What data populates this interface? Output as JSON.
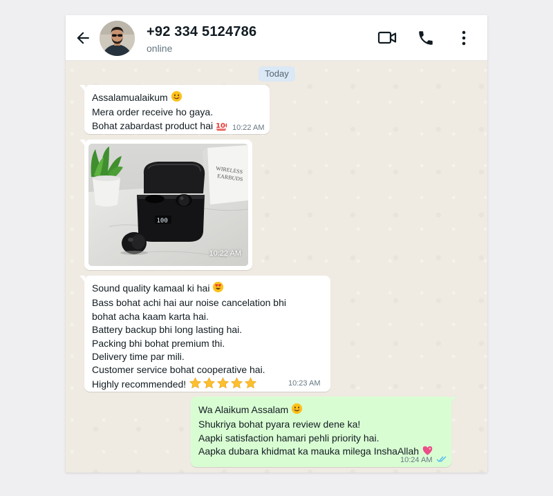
{
  "header": {
    "contact_name": "+92 334 5124786",
    "status": "online",
    "icons": [
      "back-arrow-icon",
      "video-call-icon",
      "phone-icon",
      "more-options-icon"
    ]
  },
  "chat": {
    "date_label": "Today",
    "messages": [
      {
        "direction": "incoming",
        "lines": [
          "Assalamualaikum",
          "Mera order receive ho gaya.",
          "Bohat zabardast product hai"
        ],
        "emojis": [
          "smiling-face-emoji",
          "hundred-points-emoji"
        ],
        "time": "10:22 AM"
      },
      {
        "direction": "incoming",
        "type": "image",
        "image_description": "black wireless earbuds charging case showing 100 on LED display with box",
        "case_display": "100",
        "box_text": [
          "WIRELESS",
          "EARBUDS"
        ],
        "time": "10:22 AM"
      },
      {
        "direction": "incoming",
        "lines": [
          "Sound quality kamaal ki hai",
          "Bass bohat achi hai aur noise cancelation bhi",
          "bohat acha kaam karta hai.",
          "Battery backup bhi long lasting hai.",
          "Packing bhi bohat premium thi.",
          "Delivery time par mili.",
          "Customer service bohat cooperative hai.",
          "Highly recommended!"
        ],
        "emojis": [
          "heart-eyes-emoji",
          "star-emoji"
        ],
        "rating_stars": 5,
        "time": "10:23 AM"
      },
      {
        "direction": "outgoing",
        "lines": [
          "Wa Alaikum Assalam",
          "Shukriya bohat pyara review dene ka!",
          "Aapki satisfaction hamari pehli priority hai.",
          "Aapka dubara khidmat ka mauka milega InshaAllah"
        ],
        "emojis": [
          "smiling-face-emoji",
          "sparkling-heart-emoji"
        ],
        "time": "10:24 AM",
        "read_receipt": "double-blue-ticks-icon"
      }
    ]
  },
  "colors": {
    "chat_background": "#efeae2",
    "incoming_bubble": "#ffffff",
    "outgoing_bubble": "#d9fdd3",
    "date_chip": "#dbe8f5",
    "read_tick": "#53bdeb"
  }
}
